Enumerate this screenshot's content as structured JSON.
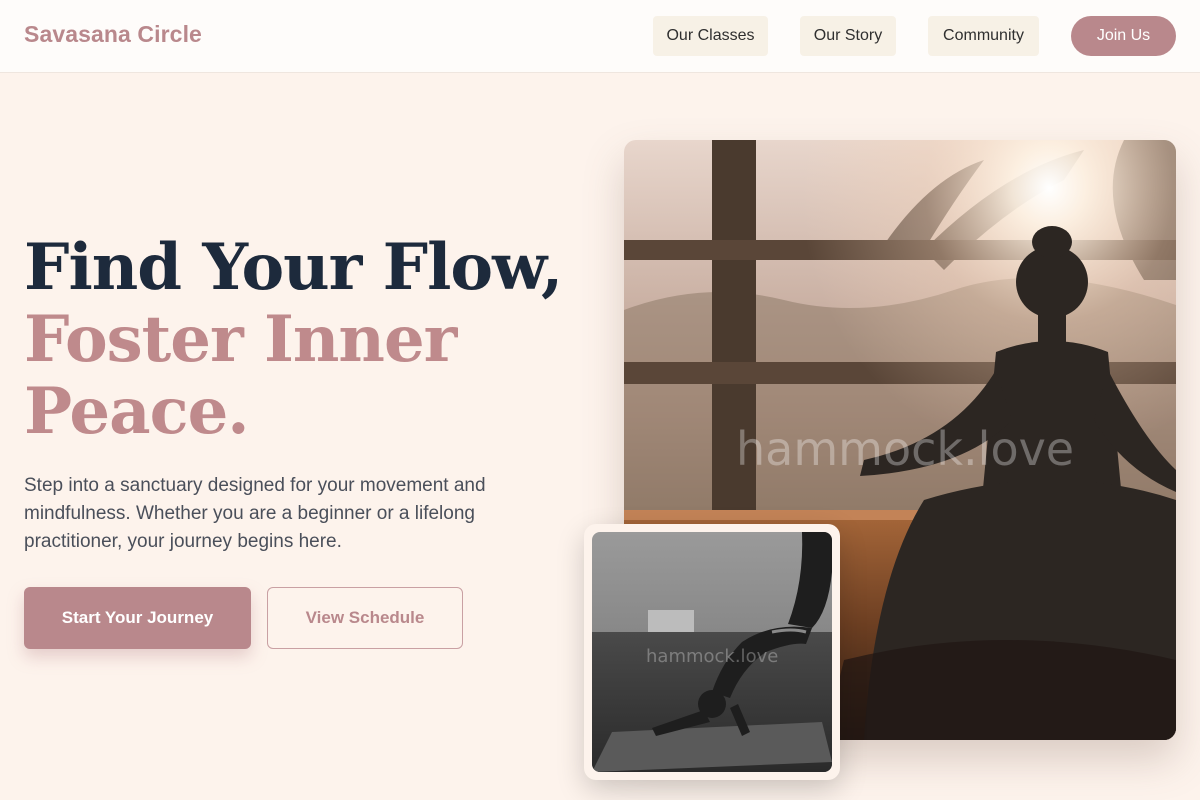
{
  "nav": {
    "brand": "Savasana Circle",
    "links": [
      "Our Classes",
      "Our Story",
      "Community"
    ],
    "cta": "Join Us"
  },
  "hero": {
    "headline_line1": "Find Your Flow,",
    "headline_line2": "Foster Inner",
    "headline_line3": "Peace.",
    "lead": "Step into a sanctuary designed for your movement and mindfulness. Whether you are a beginner or a lifelong practitioner, your journey begins here.",
    "primary_cta": "Start Your Journey",
    "secondary_cta": "View Schedule"
  },
  "images": {
    "main_watermark": "hammock.love",
    "small_watermark": "hammock.love"
  },
  "colors": {
    "background": "#fdf3ec",
    "accent": "#b9888c",
    "heading_dark": "#1d2a3c"
  }
}
